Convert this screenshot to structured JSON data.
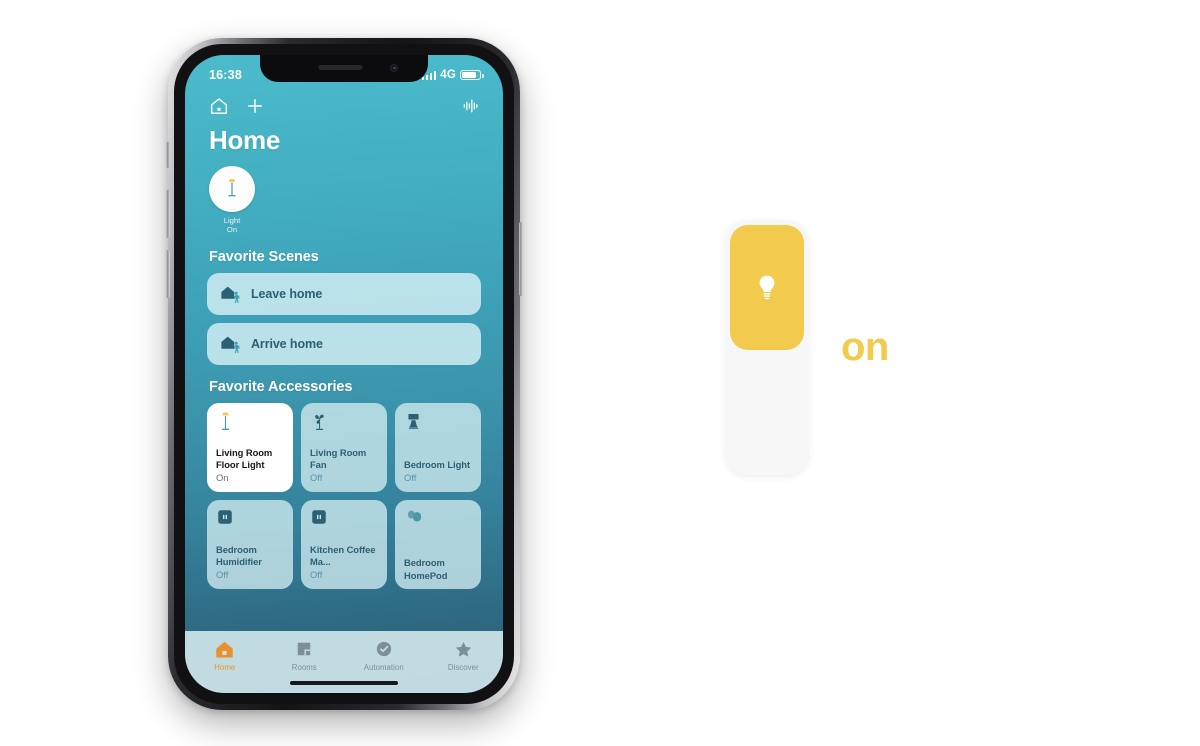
{
  "colors": {
    "accent_yellow": "#F2CA4E",
    "tab_active": "#E8922E",
    "teal_text": "#2C6073",
    "bg_top": "#4BBBCC",
    "bg_bottom": "#2A5C70"
  },
  "status_bar": {
    "time": "16:38",
    "network": "4G",
    "signal_icon": "signal-bars-icon",
    "battery_icon": "battery-icon"
  },
  "app_nav": {
    "home_icon": "house-icon",
    "add_icon": "plus-icon",
    "audio_icon": "waveform-icon"
  },
  "header": {
    "title": "Home"
  },
  "status_summary": [
    {
      "icon": "floor-lamp-icon",
      "label": "Light",
      "state": "On"
    }
  ],
  "sections": {
    "scenes_title": "Favorite Scenes",
    "accessories_title": "Favorite Accessories"
  },
  "scenes": [
    {
      "label": "Leave home",
      "icon": "house-leaving-icon"
    },
    {
      "label": "Arrive home",
      "icon": "house-arriving-icon"
    }
  ],
  "accessories": [
    {
      "name": "Living Room Floor Light",
      "state": "On",
      "icon": "floor-lamp-icon",
      "active": true
    },
    {
      "name": "Living Room Fan",
      "state": "Off",
      "icon": "fan-icon",
      "active": false
    },
    {
      "name": "Bedroom Light",
      "state": "Off",
      "icon": "table-lamp-icon",
      "active": false
    },
    {
      "name": "Bedroom Humidifier",
      "state": "Off",
      "icon": "outlet-icon",
      "active": false
    },
    {
      "name": "Kitchen Coffee Ma...",
      "state": "Off",
      "icon": "outlet-icon",
      "active": false
    },
    {
      "name": "Bedroom HomePod",
      "state": "",
      "icon": "homepod-icon",
      "active": false
    }
  ],
  "tabs": [
    {
      "label": "Home",
      "icon": "house-filled-icon",
      "active": true
    },
    {
      "label": "Rooms",
      "icon": "rooms-icon",
      "active": false
    },
    {
      "label": "Automation",
      "icon": "clock-check-icon",
      "active": false
    },
    {
      "label": "Discover",
      "icon": "star-icon",
      "active": false
    }
  ],
  "callout": {
    "label": "on",
    "icon": "lightbulb-icon",
    "fill_percent": 53
  }
}
